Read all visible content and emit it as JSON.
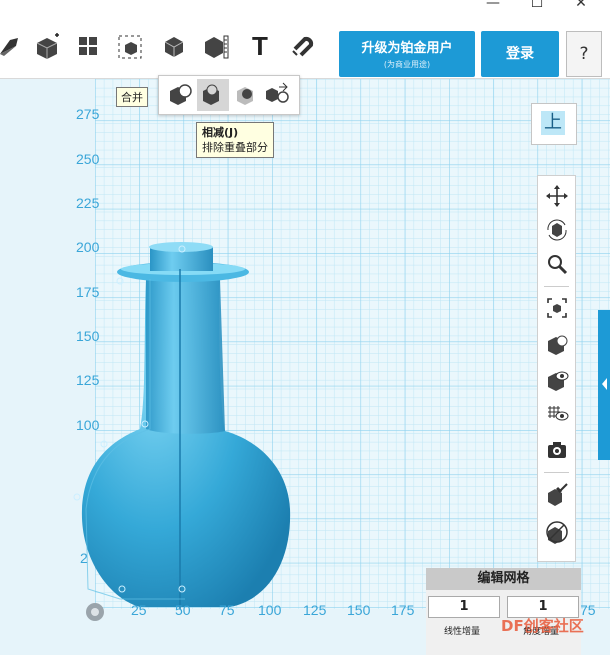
{
  "window": {
    "minimize": "—",
    "maximize": "☐",
    "close": "✕"
  },
  "toolbar": {
    "tools": [
      {
        "name": "sketch-tool-icon"
      },
      {
        "name": "transform-tool-icon"
      },
      {
        "name": "pattern-tool-icon"
      },
      {
        "name": "snap-tool-icon"
      },
      {
        "name": "combine-tool-icon"
      },
      {
        "name": "measure-tool-icon"
      },
      {
        "name": "text-tool-icon",
        "glyph": "T"
      },
      {
        "name": "magnet-tool-icon"
      }
    ],
    "upgrade_line1": "升级为铂金用户",
    "upgrade_line2": "(为商业用途)",
    "login": "登录",
    "help": "?"
  },
  "combine_popup": {
    "hover_label": "合并",
    "tooltip_title": "相减(J)",
    "tooltip_desc": "排除重叠部分"
  },
  "axis": {
    "y_ticks": [
      "275",
      "250",
      "225",
      "200",
      "175",
      "150",
      "125",
      "100",
      "2"
    ],
    "x_ticks": [
      "25",
      "50",
      "75",
      "100",
      "125",
      "150",
      "175",
      "75"
    ]
  },
  "viewcube": {
    "label": "上"
  },
  "edit_grid": {
    "title": "编辑网格",
    "value1": "1",
    "value2": "1",
    "label1": "线性增量",
    "label2": "角度增量"
  },
  "watermark": "DF创客社区",
  "colors": {
    "accent": "#1d9ad6",
    "grid_major": "#8fd2ee",
    "grid_minor": "#bfe6f5",
    "model": "#3ab0dc"
  }
}
